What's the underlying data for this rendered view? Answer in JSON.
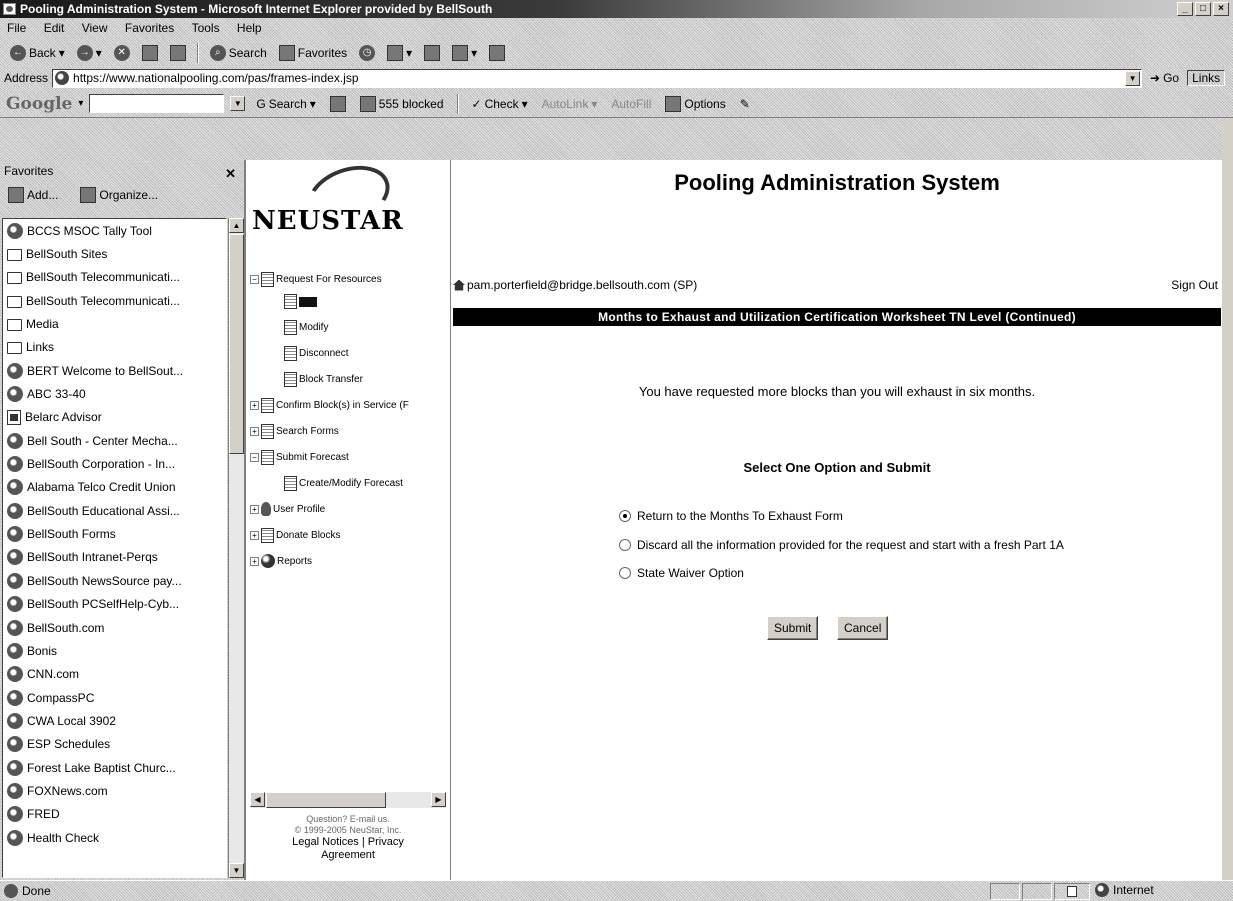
{
  "window": {
    "title": "Pooling Administration System - Microsoft Internet Explorer provided by BellSouth"
  },
  "menu": [
    "File",
    "Edit",
    "View",
    "Favorites",
    "Tools",
    "Help"
  ],
  "toolbar": {
    "back": "Back",
    "search": "Search",
    "favorites": "Favorites"
  },
  "address": {
    "label": "Address",
    "url": "https://www.nationalpooling.com/pas/frames-index.jsp",
    "go": "Go",
    "links": "Links"
  },
  "google": {
    "logo": "Google",
    "search": "Search",
    "blocked": "555 blocked",
    "check": "Check",
    "autolink": "AutoLink",
    "autofill": "AutoFill",
    "options": "Options"
  },
  "favorites": {
    "title": "Favorites",
    "add": "Add...",
    "organize": "Organize...",
    "items": [
      {
        "label": "BCCS MSOC Tally Tool",
        "icon": "globe"
      },
      {
        "label": "BellSouth Sites",
        "icon": "folder"
      },
      {
        "label": "BellSouth Telecommunicati...",
        "icon": "folder"
      },
      {
        "label": "BellSouth Telecommunicati...",
        "icon": "folder"
      },
      {
        "label": "Media",
        "icon": "folder"
      },
      {
        "label": "Links",
        "icon": "folder"
      },
      {
        "label": "BERT Welcome to BellSout...",
        "icon": "globe"
      },
      {
        "label": "ABC 33-40",
        "icon": "globe"
      },
      {
        "label": "Belarc Advisor",
        "icon": "page"
      },
      {
        "label": "Bell South - Center Mecha...",
        "icon": "globe"
      },
      {
        "label": "BellSouth Corporation - In...",
        "icon": "globe"
      },
      {
        "label": "Alabama Telco Credit Union",
        "icon": "globe"
      },
      {
        "label": "BellSouth Educational Assi...",
        "icon": "globe"
      },
      {
        "label": "BellSouth Forms",
        "icon": "globe"
      },
      {
        "label": "BellSouth Intranet-Perqs",
        "icon": "globe"
      },
      {
        "label": "BellSouth NewsSource pay...",
        "icon": "globe"
      },
      {
        "label": "BellSouth PCSelfHelp-Cyb...",
        "icon": "globe"
      },
      {
        "label": "BellSouth.com",
        "icon": "globe"
      },
      {
        "label": "Bonis",
        "icon": "globe"
      },
      {
        "label": "CNN.com",
        "icon": "globe"
      },
      {
        "label": "CompassPC",
        "icon": "globe"
      },
      {
        "label": "CWA Local 3902",
        "icon": "globe"
      },
      {
        "label": "ESP Schedules",
        "icon": "globe"
      },
      {
        "label": "Forest Lake Baptist Churc...",
        "icon": "globe"
      },
      {
        "label": "FOXNews.com",
        "icon": "globe"
      },
      {
        "label": "FRED",
        "icon": "globe"
      },
      {
        "label": "Health Check",
        "icon": "globe"
      }
    ]
  },
  "nav": {
    "logo": "NEUSTAR",
    "tree": [
      {
        "label": "Request For Resources"
      },
      {
        "label": ""
      },
      {
        "label": "Modify"
      },
      {
        "label": "Disconnect"
      },
      {
        "label": "Block Transfer"
      },
      {
        "label": "Confirm Block(s) in Service (F"
      },
      {
        "label": "Search Forms"
      },
      {
        "label": "Submit Forecast"
      },
      {
        "label": "Create/Modify Forecast"
      },
      {
        "label": "User Profile"
      },
      {
        "label": "Donate Blocks"
      },
      {
        "label": "Reports"
      }
    ],
    "footer_question": "Question? E-mail us.",
    "footer_copyright": "© 1999-2005 NeuStar, Inc.",
    "footer_links": "Legal Notices | Privacy",
    "footer_links2": "Agreement"
  },
  "main": {
    "title": "Pooling Administration System",
    "user": "pam.porterfield@bridge.bellsouth.com (SP)",
    "sign_out": "Sign Out",
    "section": "Months to Exhaust and Utilization Certification Worksheet  TN Level (Continued)",
    "message": "You have requested more blocks than you will exhaust in six months.",
    "heading": "Select One Option and Submit",
    "options": [
      {
        "label": "Return to the Months To Exhaust Form",
        "checked": true
      },
      {
        "label": "Discard all the information provided for the request and start with a fresh Part 1A",
        "checked": false
      },
      {
        "label": "State Waiver Option",
        "checked": false
      }
    ],
    "submit": "Submit",
    "cancel": "Cancel"
  },
  "status": {
    "text": "Done",
    "zone": "Internet"
  }
}
